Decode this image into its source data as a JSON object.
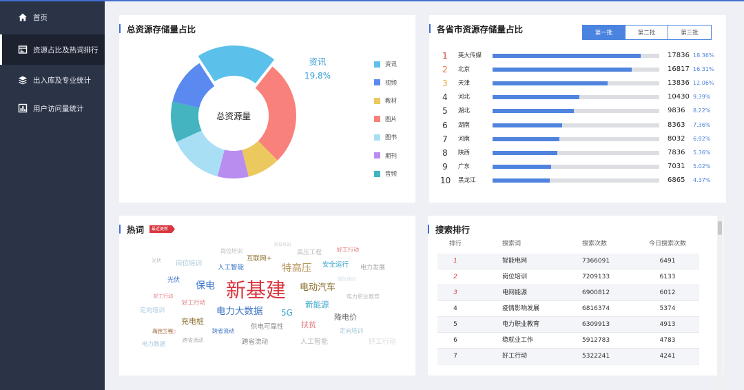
{
  "sidebar": {
    "items": [
      {
        "label": "首页",
        "icon": "home-icon"
      },
      {
        "label": "资源占比及热词排行",
        "icon": "dashboard-icon"
      },
      {
        "label": "出入库及专业统计",
        "icon": "layers-icon"
      },
      {
        "label": "用户访问量统计",
        "icon": "user-chart-icon"
      }
    ],
    "active_index": 1
  },
  "total_panel": {
    "title": "总资源存储量占比",
    "center_label": "总资源量",
    "highlight": {
      "name": "资讯",
      "pct": "19.8%"
    },
    "legend": [
      "资讯",
      "视频",
      "教材",
      "图片",
      "图书",
      "期刊",
      "音频"
    ]
  },
  "chart_data": [
    {
      "type": "pie",
      "title": "总资源存储量占比",
      "labels": [
        "资讯",
        "图片",
        "教材",
        "期刊",
        "图书",
        "音频",
        "视频"
      ],
      "values": [
        19.8,
        27.0,
        8.5,
        8.0,
        14.0,
        10.5,
        12.2
      ],
      "colors": [
        "#5bc1ea",
        "#f9817b",
        "#ecc95e",
        "#b98cf0",
        "#a9dff5",
        "#43b4c0",
        "#5a89f0"
      ],
      "highlight_index": 0
    }
  ],
  "province_panel": {
    "title": "各省市资源存储量占比",
    "tabs": [
      "第一批",
      "第二批",
      "第三批"
    ],
    "active_tab": 0,
    "rank_colors": [
      "#d9363e",
      "#e8713c",
      "#e9a93a"
    ],
    "max_value": 20100,
    "rows": [
      {
        "rank": "1",
        "name": "英大传媒",
        "value": 17836,
        "value_text": "17836",
        "pct": "18.36%"
      },
      {
        "rank": "2",
        "name": "北京",
        "value": 16817,
        "value_text": "16817",
        "pct": "16.31%"
      },
      {
        "rank": "3",
        "name": "天津",
        "value": 13836,
        "value_text": "13836",
        "pct": "12.06%"
      },
      {
        "rank": "4",
        "name": "河北",
        "value": 10430,
        "value_text": "10430",
        "pct": "9.39%"
      },
      {
        "rank": "5",
        "name": "湖北",
        "value": 9836,
        "value_text": "9836",
        "pct": "8.22%"
      },
      {
        "rank": "6",
        "name": "湖南",
        "value": 8363,
        "value_text": "8363",
        "pct": "7.36%"
      },
      {
        "rank": "7",
        "name": "河南",
        "value": 8032,
        "value_text": "8032",
        "pct": "6.92%"
      },
      {
        "rank": "8",
        "name": "陕西",
        "value": 7836,
        "value_text": "7836",
        "pct": "5.36%"
      },
      {
        "rank": "9",
        "name": "广东",
        "value": 7031,
        "value_text": "7031",
        "pct": "5.02%"
      },
      {
        "rank": "10",
        "name": "黑龙江",
        "value": 6865,
        "value_text": "6865",
        "pct": "4.37%"
      }
    ]
  },
  "hotwords_panel": {
    "title": "热词",
    "badge": "最近更新",
    "words": [
      {
        "text": "新基建",
        "color": "#d9363e"
      },
      {
        "text": "电力大数据",
        "color": "#3c74c6"
      },
      {
        "text": "电动汽车",
        "color": "#8a6d2c"
      },
      {
        "text": "保电",
        "color": "#3c74c6"
      },
      {
        "text": "特高压",
        "color": "#b7965c"
      },
      {
        "text": "新能源",
        "color": "#3aa6c8"
      },
      {
        "text": "5G",
        "color": "#3aa6c8"
      },
      {
        "text": "充电桩",
        "color": "#8a6d2c"
      },
      {
        "text": "降电价",
        "color": "#666666"
      },
      {
        "text": "扶贫",
        "color": "#e2777c"
      },
      {
        "text": "人工智能",
        "color": "#3c74c6"
      },
      {
        "text": "互联网+",
        "color": "#8a6d2c"
      },
      {
        "text": "安全运行",
        "color": "#3aa6c8"
      },
      {
        "text": "电力发展",
        "color": "#aaaaaa"
      },
      {
        "text": "光伏",
        "color": "#3c74c6"
      },
      {
        "text": "岗位培训",
        "color": "#a9c8dc"
      },
      {
        "text": "好工行动",
        "color": "#e2777c"
      },
      {
        "text": "好工行动",
        "color": "#e2777c"
      },
      {
        "text": "好工行动",
        "color": "#f2b3b5"
      },
      {
        "text": "高压工程",
        "color": "#bbbbbb"
      },
      {
        "text": "岗位培训",
        "color": "#bbbbbb"
      },
      {
        "text": "光伏",
        "color": "#bbbbbb"
      },
      {
        "text": "岗位培训",
        "color": "#c8dbe8"
      },
      {
        "text": "电力职业教育",
        "color": "#bbbbbb"
      },
      {
        "text": "定向培训",
        "color": "#a9c8dc"
      },
      {
        "text": "好工行动",
        "color": "#e2777c"
      },
      {
        "text": "高压工程",
        "color": "#8a6d2c"
      },
      {
        "text": "跨省流动",
        "color": "#3c74c6"
      },
      {
        "text": "供电可靠性",
        "color": "#888888"
      },
      {
        "text": "跨省流动",
        "color": "#aaaaaa"
      },
      {
        "text": "跨省流动",
        "color": "#888888"
      },
      {
        "text": "人工智能",
        "color": "#bbbbbb"
      },
      {
        "text": "电力数据",
        "color": "#a9c8dc"
      },
      {
        "text": "定向培训",
        "color": "#a9c8dc"
      },
      {
        "text": "好工行动",
        "color": "#dddddd"
      },
      {
        "text": "岗位培训",
        "color": "#cccccc"
      }
    ]
  },
  "search_panel": {
    "title": "搜索排行",
    "headers": [
      "排行",
      "搜索词",
      "搜索次数",
      "今日搜索次数"
    ],
    "rank_color": "#d9363e",
    "rows": [
      {
        "rank": "1",
        "word": "智能电网",
        "count": "7366091",
        "today": "6491"
      },
      {
        "rank": "2",
        "word": "岗位培训",
        "count": "7209133",
        "today": "6133"
      },
      {
        "rank": "3",
        "word": "电网能源",
        "count": "6900812",
        "today": "6012"
      },
      {
        "rank": "4",
        "word": "疫情影响发展",
        "count": "6816374",
        "today": "5374"
      },
      {
        "rank": "5",
        "word": "电力职业教育",
        "count": "6309913",
        "today": "4913"
      },
      {
        "rank": "6",
        "word": "稳就业工作",
        "count": "5912783",
        "today": "4783"
      },
      {
        "rank": "7",
        "word": "好工行动",
        "count": "5322241",
        "today": "4241"
      }
    ]
  }
}
